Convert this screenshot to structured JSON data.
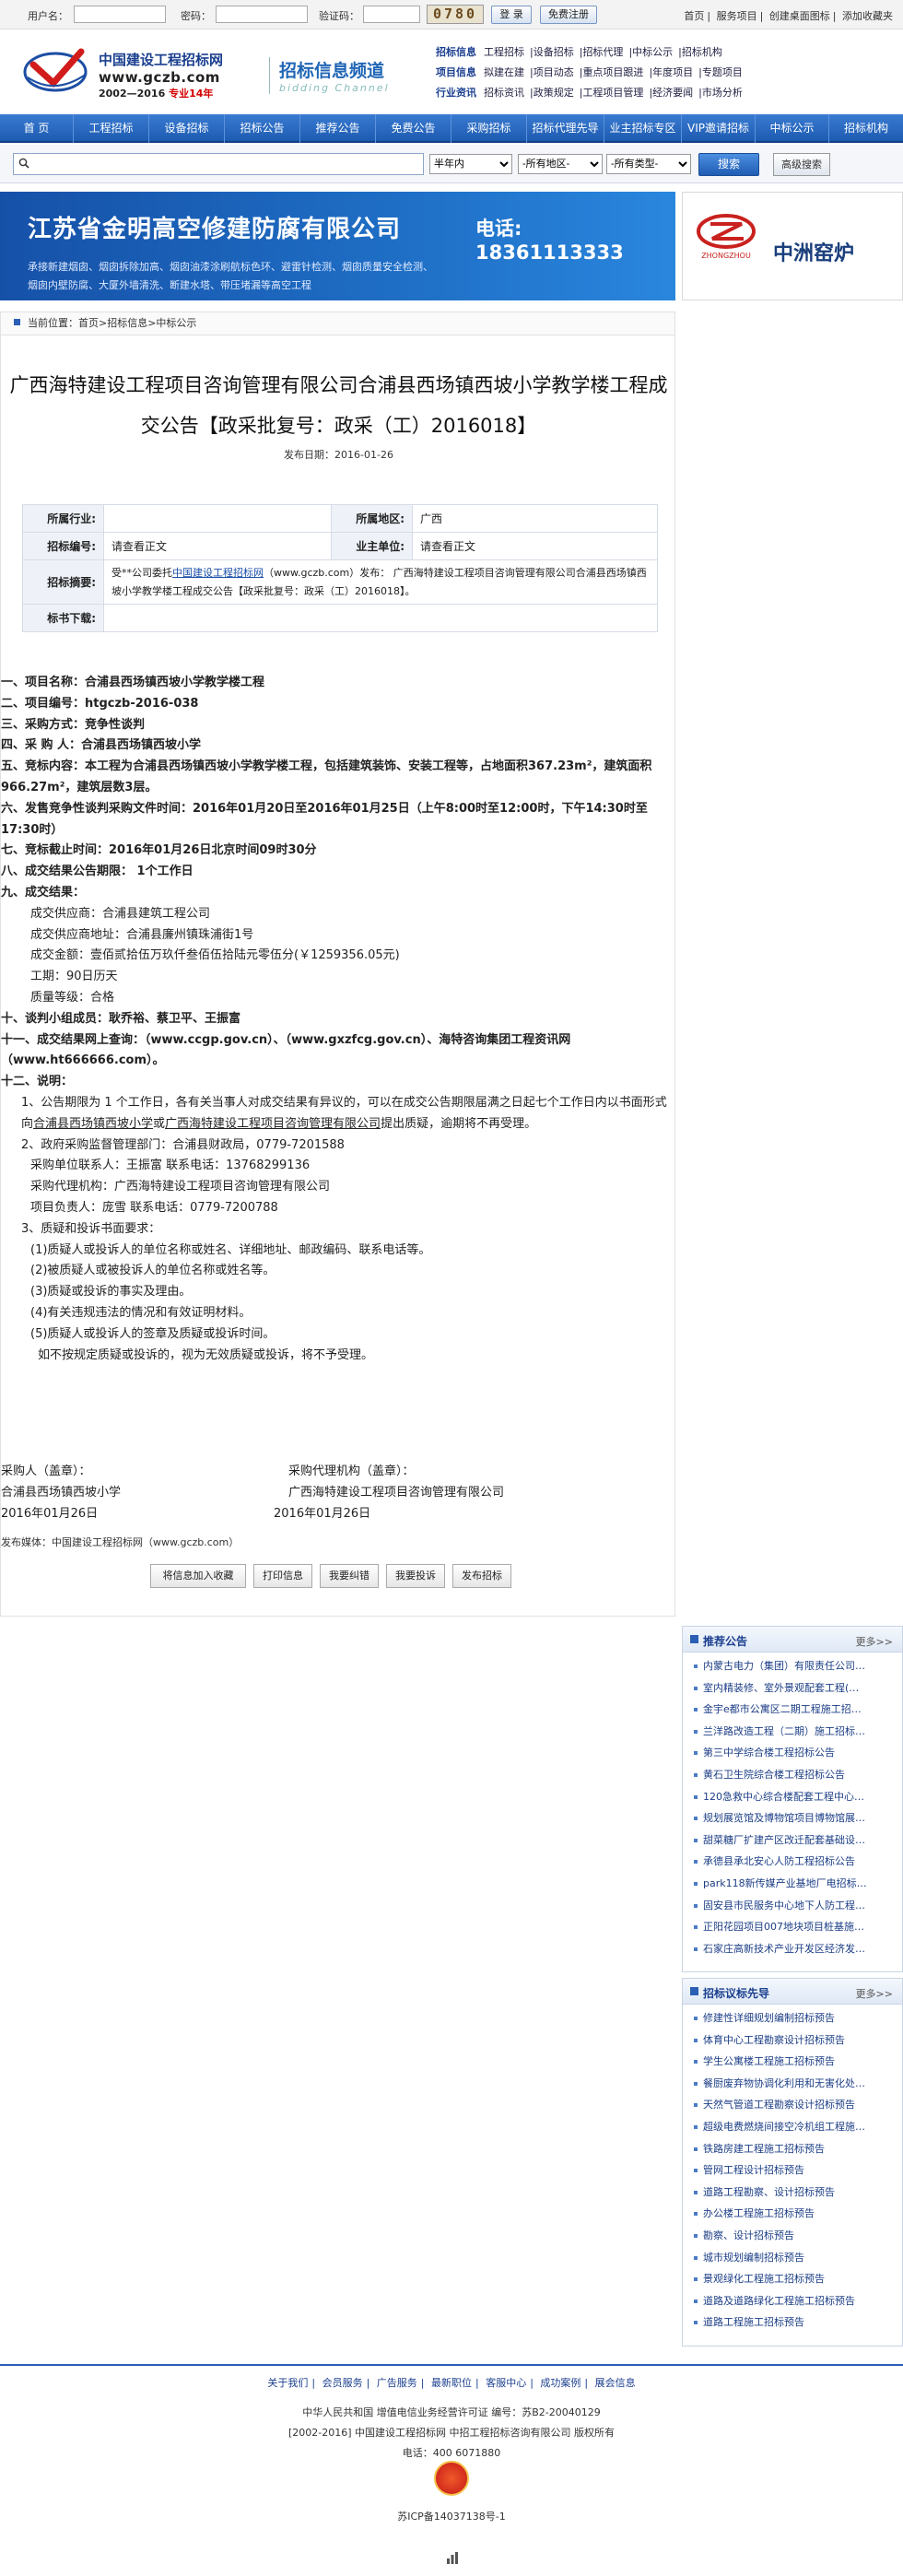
{
  "login": {
    "user_label": "用户名：",
    "password_label": "密码：",
    "captcha_label": "验证码：",
    "captcha_text": "0780",
    "login_btn": "登 录",
    "register_btn": "免费注册"
  },
  "toplinks": [
    "首页",
    "服务项目",
    "创建桌面图标",
    "添加收藏夹"
  ],
  "brand": {
    "name": "中国建设工程招标网",
    "url": "www.gczb.com",
    "years": "2002—2016",
    "years_tag": "专业14年",
    "channel": "招标信息频道",
    "channel_en": "bidding Channel"
  },
  "catnav": [
    {
      "head": "招标信息",
      "items": [
        "工程招标",
        "设备招标",
        "招标代理",
        "中标公示",
        "招标机构"
      ]
    },
    {
      "head": "项目信息",
      "items": [
        "拟建在建",
        "项目动态",
        "重点项目跟进",
        "年度项目",
        "专题项目"
      ]
    },
    {
      "head": "行业资讯",
      "items": [
        "招标资讯",
        "政策规定",
        "工程项目管理",
        "经济要闻",
        "市场分析"
      ]
    }
  ],
  "mainnav": [
    "首 页",
    "工程招标",
    "设备招标",
    "招标公告",
    "推荐公告",
    "免费公告",
    "采购招标",
    "招标代理先导",
    "业主招标专区",
    "VIP邀请招标",
    "中标公示",
    "招标机构"
  ],
  "search": {
    "placeholder": "",
    "period": "半年内",
    "region": "-所有地区-",
    "type": "-所有类型-",
    "btn": "搜索",
    "adv": "高级搜索"
  },
  "ad1": {
    "title": "江苏省金明高空修建防腐有限公司",
    "phone": "电话: 18361113333",
    "lines": [
      "承接新建烟囱、烟囱拆除加高、烟囱油漆涂刷航标色环、避雷针检测、烟囱质量安全检测、",
      "烟囱内壁防腐、大厦外墙清洗、断建水塔、带压堵漏等高空工程"
    ]
  },
  "ad2": {
    "logo_caption": "ZHONGZHOU",
    "title": "中洲窑炉"
  },
  "breadcrumb": "当前位置：首页>招标信息>中标公示",
  "article": {
    "title": "广西海特建设工程项目咨询管理有限公司合浦县西场镇西坡小学教学楼工程成交公告【政采批复号：政采（工）2016018】",
    "date_label": "发布日期：",
    "date": "2016-01-26"
  },
  "meta": {
    "industry_label": "所属行业:",
    "industry": "",
    "region_label": "所属地区:",
    "region": "广西",
    "code_label": "招标编号:",
    "code": "请查看正文",
    "owner_label": "业主单位:",
    "owner": "请查看正文",
    "summary_label": "招标摘要:",
    "summary_pre": "受**公司委托",
    "summary_link": "中国建设工程招标网",
    "summary_url": "（www.gczb.com）",
    "summary_post": "发布：  广西海特建设工程项目咨询管理有限公司合浦县西场镇西坡小学教学楼工程成交公告【政采批复号：政采（工）2016018】。",
    "tag_label": "标书下载:",
    "tag": ""
  },
  "body": {
    "l1": "一、项目名称：合浦县西场镇西坡小学教学楼工程",
    "l2": "二、项目编号：htgczb-2016-038",
    "l3": "三、采购方式：竞争性谈判",
    "l4": "四、采 购 人：合浦县西场镇西坡小学",
    "l5": "五、竞标内容：本工程为合浦县西场镇西坡小学教学楼工程，包括建筑装饰、安装工程等，占地面积367.23m²，建筑面积966.27m²，建筑层数3层。",
    "l6": "六、发售竞争性谈判采购文件时间：2016年01月20日至2016年01月25日（上午8:00时至12:00时，下午14:30时至17:30时）",
    "l7": "七、竞标截止时间：2016年01月26日北京时间09时30分",
    "l8": "八、成交结果公告期限： 1个工作日",
    "l9": "九、成交结果：",
    "l9a": "成交供应商：合浦县建筑工程公司",
    "l9b": "成交供应商地址：合浦县廉州镇珠浦街1号",
    "l9c": "成交金额：壹佰贰拾伍万玖仟叁佰伍拾陆元零伍分(￥1259356.05元)",
    "l9d": "工期：90日历天",
    "l9e": "质量等级：合格",
    "l10": "十、谈判小组成员：耿乔裕、蔡卫平、王振富",
    "l11": "十一、成交结果网上查询：（www.ccgp.gov.cn）、（www.gxzfcg.gov.cn）、海特咨询集团工程资讯网（www.ht666666.com）。",
    "l12": "十二、说明：",
    "n1a": "1、公告期限为 1 个工作日，各有关当事人对成交结果有异议的，可以在成交公告期限届满之日起七个工作日内以书面形式向",
    "n1u1": "合浦县西场镇西坡小学",
    "n1m": "或",
    "n1u2": "广西海特建设工程项目咨询管理有限公司",
    "n1b": "提出质疑，逾期将不再受理。",
    "n2": "2、政府采购监督管理部门：合浦县财政局，0779-7201588",
    "n3": "采购单位联系人：王振富        联系电话：13768299136",
    "n4": "采购代理机构：广西海特建设工程项目咨询管理有限公司",
    "n5": "项目负责人：庞雪        联系电话：0779-7200788",
    "n6": "3、质疑和投诉书面要求：",
    "n7": "(1)质疑人或投诉人的单位名称或姓名、详细地址、邮政编码、联系电话等。",
    "n8": "(2)被质疑人或被投诉人的单位名称或姓名等。",
    "n9": "(3)质疑或投诉的事实及理由。",
    "n10": "(4)有关违规违法的情况和有效证明材料。",
    "n11": "(5)质疑人或投诉人的签章及质疑或投诉时间。",
    "n12": "如不按规定质疑或投诉的，视为无效质疑或投诉，将不予受理。"
  },
  "sign": {
    "buyer_label": "采购人（盖章）：",
    "buyer": "合浦县西场镇西坡小学",
    "buyer_date": "2016年01月26日",
    "agent_label": "采购代理机构（盖章）：",
    "agent": "广西海特建设工程项目咨询管理有限公司",
    "agent_date": "2016年01月26日"
  },
  "media_source": "发布媒体：中国建设工程招标网（www.gczb.com）",
  "actions": [
    "将信息加入收藏",
    "打印信息",
    "我要纠错",
    "我要投诉",
    "发布招标"
  ],
  "side1": {
    "title": "推荐公告",
    "more": "更多>>",
    "items": [
      "内蒙古电力（集团）有限责任公司…",
      "室内精装修、室外景观配套工程(…",
      "金宇e都市公寓区二期工程施工招…",
      "兰洋路改造工程（二期）施工招标…",
      "第三中学综合楼工程招标公告",
      "黄石卫生院综合楼工程招标公告",
      "120急救中心综合楼配套工程中心…",
      "规划展览馆及博物馆项目博物馆展…",
      "甜菜糖厂扩建产区改迁配套基础设…",
      "承德县承北安心人防工程招标公告",
      "park118新传媒产业基地厂电招标…",
      "固安县市民服务中心地下人防工程…",
      "正阳花园项目007地块项目桩基施…",
      "石家庄高新技术产业开发区经济发…"
    ]
  },
  "side2": {
    "title": "招标议标先导",
    "more": "更多>>",
    "items": [
      "修建性详细规划编制招标预告",
      "体育中心工程勘察设计招标预告",
      "学生公寓楼工程施工招标预告",
      "餐厨废弃物协调化利用和无害化处…",
      "天然气管道工程勘察设计招标预告",
      "超级电费燃烧间接空冷机组工程施…",
      "铁路房建工程施工招标预告",
      "管网工程设计招标预告",
      "道路工程勘察、设计招标预告",
      "办公楼工程施工招标预告",
      "勘察、设计招标预告",
      "城市规划编制招标预告",
      "景观绿化工程施工招标预告",
      "道路及道路绿化工程施工招标预告",
      "道路工程施工招标预告"
    ]
  },
  "footer": {
    "links": [
      "关于我们",
      "会员服务",
      "广告服务",
      "最新职位",
      "客服中心",
      "成功案例",
      "展会信息"
    ],
    "line1": "中华人民共和国  增值电信业务经营许可证  编号：苏B2-20040129",
    "line2": "[2002-2016] 中国建设工程招标网  中招工程招标咨询有限公司  版权所有",
    "line3": "电话：400 6071880",
    "icp": "苏ICP备14037138号-1"
  }
}
